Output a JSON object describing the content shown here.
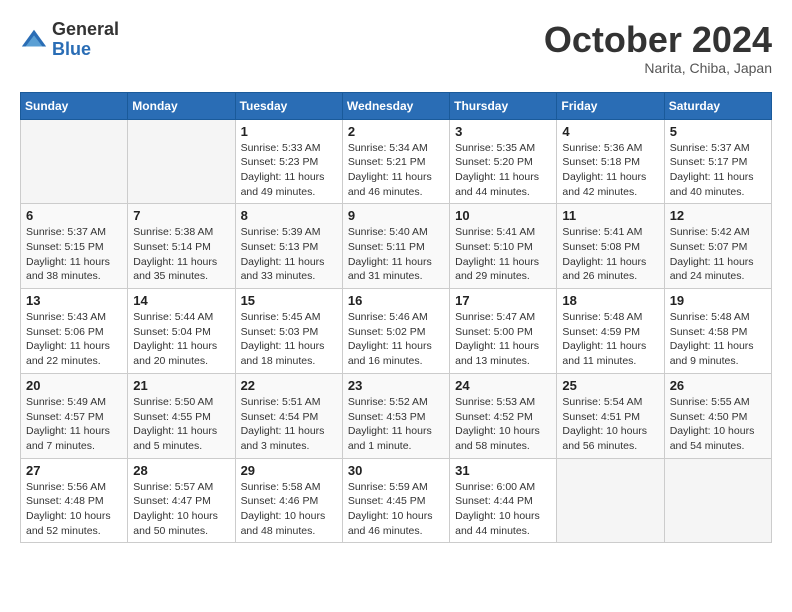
{
  "header": {
    "logo": {
      "general": "General",
      "blue": "Blue"
    },
    "title": "October 2024",
    "location": "Narita, Chiba, Japan"
  },
  "weekdays": [
    "Sunday",
    "Monday",
    "Tuesday",
    "Wednesday",
    "Thursday",
    "Friday",
    "Saturday"
  ],
  "weeks": [
    [
      {
        "day": "",
        "sunrise": "",
        "sunset": "",
        "daylight": ""
      },
      {
        "day": "",
        "sunrise": "",
        "sunset": "",
        "daylight": ""
      },
      {
        "day": "1",
        "sunrise": "Sunrise: 5:33 AM",
        "sunset": "Sunset: 5:23 PM",
        "daylight": "Daylight: 11 hours and 49 minutes."
      },
      {
        "day": "2",
        "sunrise": "Sunrise: 5:34 AM",
        "sunset": "Sunset: 5:21 PM",
        "daylight": "Daylight: 11 hours and 46 minutes."
      },
      {
        "day": "3",
        "sunrise": "Sunrise: 5:35 AM",
        "sunset": "Sunset: 5:20 PM",
        "daylight": "Daylight: 11 hours and 44 minutes."
      },
      {
        "day": "4",
        "sunrise": "Sunrise: 5:36 AM",
        "sunset": "Sunset: 5:18 PM",
        "daylight": "Daylight: 11 hours and 42 minutes."
      },
      {
        "day": "5",
        "sunrise": "Sunrise: 5:37 AM",
        "sunset": "Sunset: 5:17 PM",
        "daylight": "Daylight: 11 hours and 40 minutes."
      }
    ],
    [
      {
        "day": "6",
        "sunrise": "Sunrise: 5:37 AM",
        "sunset": "Sunset: 5:15 PM",
        "daylight": "Daylight: 11 hours and 38 minutes."
      },
      {
        "day": "7",
        "sunrise": "Sunrise: 5:38 AM",
        "sunset": "Sunset: 5:14 PM",
        "daylight": "Daylight: 11 hours and 35 minutes."
      },
      {
        "day": "8",
        "sunrise": "Sunrise: 5:39 AM",
        "sunset": "Sunset: 5:13 PM",
        "daylight": "Daylight: 11 hours and 33 minutes."
      },
      {
        "day": "9",
        "sunrise": "Sunrise: 5:40 AM",
        "sunset": "Sunset: 5:11 PM",
        "daylight": "Daylight: 11 hours and 31 minutes."
      },
      {
        "day": "10",
        "sunrise": "Sunrise: 5:41 AM",
        "sunset": "Sunset: 5:10 PM",
        "daylight": "Daylight: 11 hours and 29 minutes."
      },
      {
        "day": "11",
        "sunrise": "Sunrise: 5:41 AM",
        "sunset": "Sunset: 5:08 PM",
        "daylight": "Daylight: 11 hours and 26 minutes."
      },
      {
        "day": "12",
        "sunrise": "Sunrise: 5:42 AM",
        "sunset": "Sunset: 5:07 PM",
        "daylight": "Daylight: 11 hours and 24 minutes."
      }
    ],
    [
      {
        "day": "13",
        "sunrise": "Sunrise: 5:43 AM",
        "sunset": "Sunset: 5:06 PM",
        "daylight": "Daylight: 11 hours and 22 minutes."
      },
      {
        "day": "14",
        "sunrise": "Sunrise: 5:44 AM",
        "sunset": "Sunset: 5:04 PM",
        "daylight": "Daylight: 11 hours and 20 minutes."
      },
      {
        "day": "15",
        "sunrise": "Sunrise: 5:45 AM",
        "sunset": "Sunset: 5:03 PM",
        "daylight": "Daylight: 11 hours and 18 minutes."
      },
      {
        "day": "16",
        "sunrise": "Sunrise: 5:46 AM",
        "sunset": "Sunset: 5:02 PM",
        "daylight": "Daylight: 11 hours and 16 minutes."
      },
      {
        "day": "17",
        "sunrise": "Sunrise: 5:47 AM",
        "sunset": "Sunset: 5:00 PM",
        "daylight": "Daylight: 11 hours and 13 minutes."
      },
      {
        "day": "18",
        "sunrise": "Sunrise: 5:48 AM",
        "sunset": "Sunset: 4:59 PM",
        "daylight": "Daylight: 11 hours and 11 minutes."
      },
      {
        "day": "19",
        "sunrise": "Sunrise: 5:48 AM",
        "sunset": "Sunset: 4:58 PM",
        "daylight": "Daylight: 11 hours and 9 minutes."
      }
    ],
    [
      {
        "day": "20",
        "sunrise": "Sunrise: 5:49 AM",
        "sunset": "Sunset: 4:57 PM",
        "daylight": "Daylight: 11 hours and 7 minutes."
      },
      {
        "day": "21",
        "sunrise": "Sunrise: 5:50 AM",
        "sunset": "Sunset: 4:55 PM",
        "daylight": "Daylight: 11 hours and 5 minutes."
      },
      {
        "day": "22",
        "sunrise": "Sunrise: 5:51 AM",
        "sunset": "Sunset: 4:54 PM",
        "daylight": "Daylight: 11 hours and 3 minutes."
      },
      {
        "day": "23",
        "sunrise": "Sunrise: 5:52 AM",
        "sunset": "Sunset: 4:53 PM",
        "daylight": "Daylight: 11 hours and 1 minute."
      },
      {
        "day": "24",
        "sunrise": "Sunrise: 5:53 AM",
        "sunset": "Sunset: 4:52 PM",
        "daylight": "Daylight: 10 hours and 58 minutes."
      },
      {
        "day": "25",
        "sunrise": "Sunrise: 5:54 AM",
        "sunset": "Sunset: 4:51 PM",
        "daylight": "Daylight: 10 hours and 56 minutes."
      },
      {
        "day": "26",
        "sunrise": "Sunrise: 5:55 AM",
        "sunset": "Sunset: 4:50 PM",
        "daylight": "Daylight: 10 hours and 54 minutes."
      }
    ],
    [
      {
        "day": "27",
        "sunrise": "Sunrise: 5:56 AM",
        "sunset": "Sunset: 4:48 PM",
        "daylight": "Daylight: 10 hours and 52 minutes."
      },
      {
        "day": "28",
        "sunrise": "Sunrise: 5:57 AM",
        "sunset": "Sunset: 4:47 PM",
        "daylight": "Daylight: 10 hours and 50 minutes."
      },
      {
        "day": "29",
        "sunrise": "Sunrise: 5:58 AM",
        "sunset": "Sunset: 4:46 PM",
        "daylight": "Daylight: 10 hours and 48 minutes."
      },
      {
        "day": "30",
        "sunrise": "Sunrise: 5:59 AM",
        "sunset": "Sunset: 4:45 PM",
        "daylight": "Daylight: 10 hours and 46 minutes."
      },
      {
        "day": "31",
        "sunrise": "Sunrise: 6:00 AM",
        "sunset": "Sunset: 4:44 PM",
        "daylight": "Daylight: 10 hours and 44 minutes."
      },
      {
        "day": "",
        "sunrise": "",
        "sunset": "",
        "daylight": ""
      },
      {
        "day": "",
        "sunrise": "",
        "sunset": "",
        "daylight": ""
      }
    ]
  ]
}
